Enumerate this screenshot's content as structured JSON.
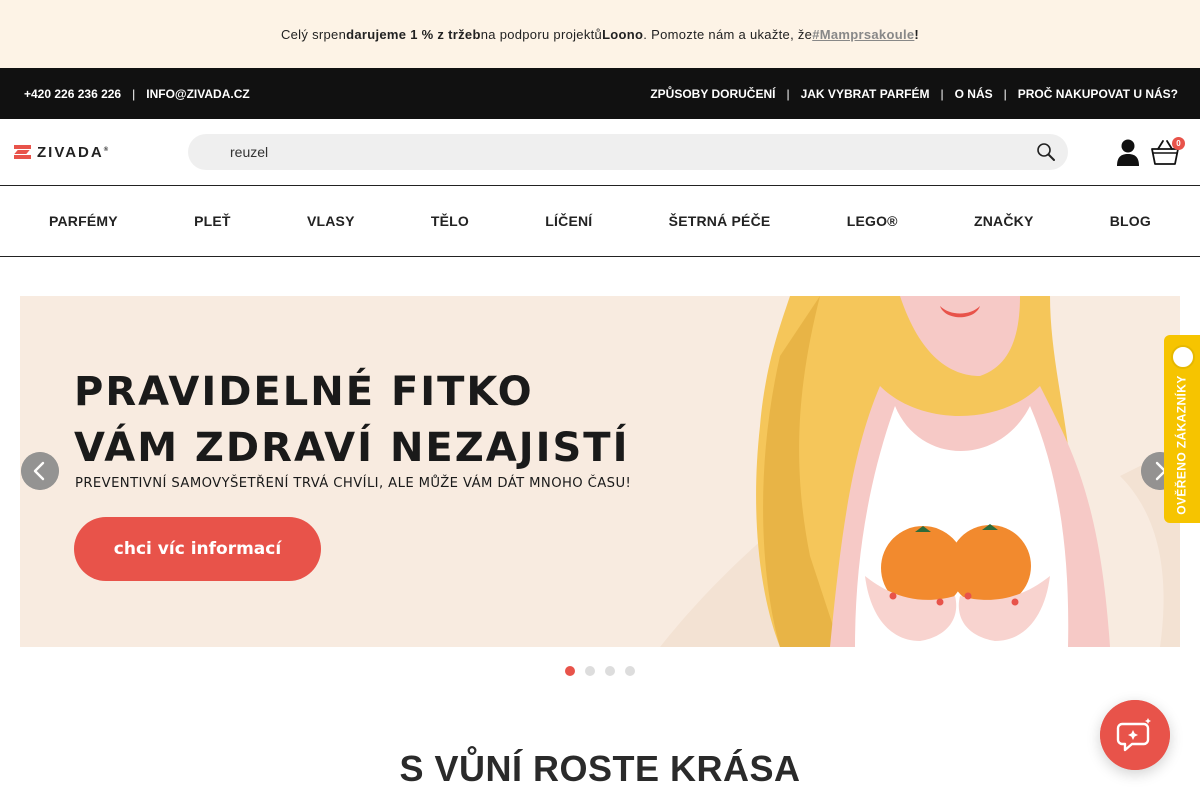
{
  "promo": {
    "text_1": "Celý srpen ",
    "bold_1": "darujeme 1 % z tržeb",
    "text_2": " na podporu projektů ",
    "bold_2": "Loono",
    "text_3": ". Pomozte nám a ukažte, že ",
    "hashtag": "#Mamprsakoule",
    "text_4": "!"
  },
  "topbar": {
    "phone": "+420 226 236 226",
    "separator": "|",
    "email": "INFO@ZIVADA.CZ",
    "links": [
      "ZPŮSOBY DORUČENÍ",
      "JAK VYBRAT PARFÉM",
      "O NÁS",
      "PROČ NAKUPOVAT U NÁS?"
    ]
  },
  "header": {
    "logo_text": "ZIVADA",
    "logo_mark": "®",
    "search_value": "reuzel",
    "cart_count": "0"
  },
  "nav": {
    "items": [
      "PARFÉMY",
      "PLEŤ",
      "VLASY",
      "TĚLO",
      "LÍČENÍ",
      "ŠETRNÁ PÉČE",
      "LEGO®",
      "ZNAČKY",
      "BLOG"
    ]
  },
  "banner": {
    "title_line_1": "PRAVIDELNÉ FITKO",
    "title_line_2": "VÁM ZDRAVÍ NEZAJISTÍ",
    "subtitle": "PREVENTIVNÍ SAMOVYŠETŘENÍ TRVÁ CHVÍLI, ALE MŮŽE VÁM DÁT MNOHO ČASU!",
    "cta_label": "chci víc informací",
    "slides": 4,
    "active_slide": 1
  },
  "badge": {
    "label": "OVĚŘENO ZÁKAZNÍKY"
  },
  "section": {
    "title": "S VŮNÍ ROSTE KRÁSA"
  },
  "colors": {
    "accent": "#e8534a",
    "topbar_bg": "#111111",
    "promo_bg": "#fdf3e6",
    "banner_bg": "#f8ebe0",
    "badge_bg": "#f6c400"
  }
}
